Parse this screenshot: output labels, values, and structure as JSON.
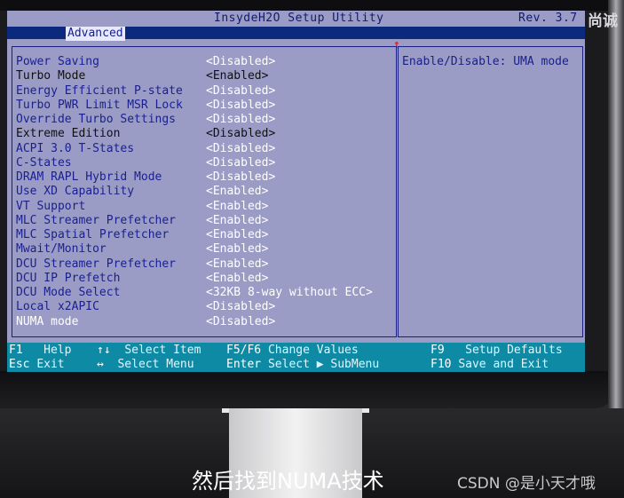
{
  "header": {
    "title": "InsydeH2O Setup Utility",
    "revision": "Rev. 3.7"
  },
  "tabs": [
    {
      "label": "Advanced"
    }
  ],
  "settings": [
    {
      "label": "Power Saving",
      "value": "<Disabled>",
      "style": "normal"
    },
    {
      "label": "Turbo Mode",
      "value": "<Enabled>",
      "style": "dark"
    },
    {
      "label": "Energy Efficient P-state",
      "value": "<Disabled>",
      "style": "normal"
    },
    {
      "label": "Turbo PWR Limit MSR Lock",
      "value": "<Disabled>",
      "style": "normal"
    },
    {
      "label": "Override Turbo Settings",
      "value": "<Disabled>",
      "style": "normal"
    },
    {
      "label": "Extreme Edition",
      "value": "<Disabled>",
      "style": "dark"
    },
    {
      "label": "ACPI 3.0 T-States",
      "value": "<Disabled>",
      "style": "normal"
    },
    {
      "label": "C-States",
      "value": "<Disabled>",
      "style": "normal"
    },
    {
      "label": "DRAM RAPL Hybrid Mode",
      "value": "<Disabled>",
      "style": "normal"
    },
    {
      "label": "Use XD Capability",
      "value": "<Enabled>",
      "style": "normal"
    },
    {
      "label": "VT Support",
      "value": "<Enabled>",
      "style": "normal"
    },
    {
      "label": "MLC Streamer Prefetcher",
      "value": "<Enabled>",
      "style": "normal"
    },
    {
      "label": "MLC Spatial Prefetcher",
      "value": "<Enabled>",
      "style": "normal"
    },
    {
      "label": "Mwait/Monitor",
      "value": "<Enabled>",
      "style": "normal"
    },
    {
      "label": "DCU Streamer Prefetcher",
      "value": "<Enabled>",
      "style": "normal"
    },
    {
      "label": "DCU IP Prefetch",
      "value": "<Enabled>",
      "style": "normal"
    },
    {
      "label": "DCU Mode Select",
      "value": "<32KB 8-way without ECC>",
      "style": "normal"
    },
    {
      "label": "Local x2APIC",
      "value": "<Disabled>",
      "style": "normal"
    },
    {
      "label": "NUMA mode",
      "value": "<Disabled>",
      "style": "selected"
    }
  ],
  "help": {
    "text": "Enable/Disable: UMA mode"
  },
  "footer": [
    {
      "key": "F1",
      "desc": "Help"
    },
    {
      "key": "↑↓",
      "desc": "Select Item"
    },
    {
      "key": "F5/F6",
      "desc": "Change Values"
    },
    {
      "key": "F9",
      "desc": "Setup Defaults"
    },
    {
      "key": "Esc",
      "desc": "Exit"
    },
    {
      "key": "↔",
      "desc": "Select Menu"
    },
    {
      "key": "Enter",
      "desc": "Select ▶ SubMenu"
    },
    {
      "key": "F10",
      "desc": "Save and Exit"
    }
  ],
  "overlay": {
    "top_watermark": "尚诚",
    "caption": "然后找到NUMA技术",
    "csdn": "CSDN @是小天才哦"
  }
}
